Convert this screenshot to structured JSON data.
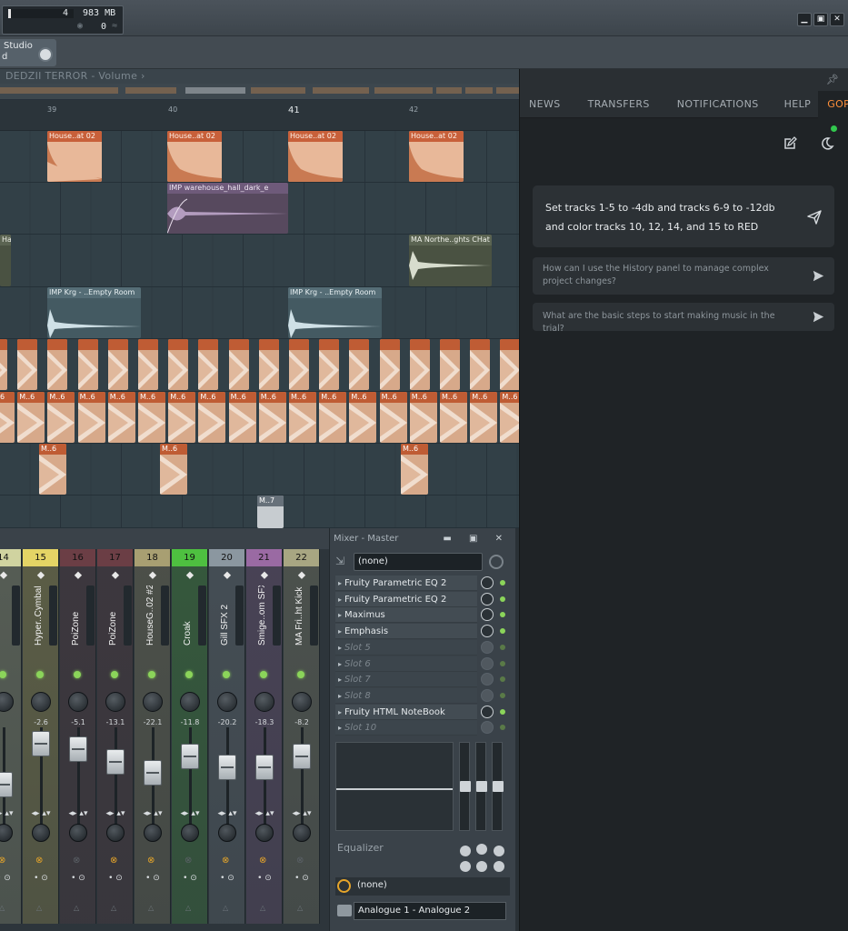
{
  "topbar": {
    "meter_count": "4",
    "meter_mem": "983 MB",
    "meter_poly": "0",
    "win_min": "▁",
    "win_max": "▣",
    "win_close": "✕"
  },
  "studio": {
    "line1": "Studio",
    "line2": "d"
  },
  "playlist": {
    "title": "DEDZII TERROR - Volume ›",
    "ruler": [
      "39",
      "40",
      "41",
      "42"
    ],
    "clips": {
      "house": "House..at 02",
      "imp_warehouse": "IMP warehouse_hall_dark_e",
      "hat_left": "Hat",
      "ma_northe": "MA Northe..ghts CHat",
      "imp_krg": "IMP Krg - ..Empty Room",
      "m6": "M..6",
      "m7": "M..7"
    }
  },
  "mixer": {
    "strips": [
      {
        "num": "14",
        "name": "",
        "val": "",
        "color": "#d0d3a0"
      },
      {
        "num": "15",
        "name": "Hyper..Cymbal",
        "val": "-2.6",
        "color": "#e4d465"
      },
      {
        "num": "16",
        "name": "PoiZone",
        "val": "-5.1",
        "color": "#6b3e45"
      },
      {
        "num": "17",
        "name": "PoiZone",
        "val": "-13.1",
        "color": "#6b3e45"
      },
      {
        "num": "18",
        "name": "HouseG..02 #2",
        "val": "-22.1",
        "color": "#a89f72"
      },
      {
        "num": "19",
        "name": "Croak",
        "val": "-11.8",
        "color": "#4ec040"
      },
      {
        "num": "20",
        "name": "Gill SFX 2",
        "val": "-20.2",
        "color": "#8b97a0"
      },
      {
        "num": "21",
        "name": "Smige..om SFX",
        "val": "-18.3",
        "color": "#9a6aa3"
      },
      {
        "num": "22",
        "name": "MA Fri..ht Kick",
        "val": "-8.2",
        "color": "#a8a682"
      }
    ],
    "master": {
      "title": "Mixer - Master",
      "win_buttons": "▬ ▣ ✕",
      "input": "(none)",
      "slots": [
        {
          "label": "Fruity Parametric EQ 2",
          "empty": false
        },
        {
          "label": "Fruity Parametric EQ 2",
          "empty": false
        },
        {
          "label": "Maximus",
          "empty": false
        },
        {
          "label": "Emphasis",
          "empty": false
        },
        {
          "label": "Slot 5",
          "empty": true
        },
        {
          "label": "Slot 6",
          "empty": true
        },
        {
          "label": "Slot 7",
          "empty": true
        },
        {
          "label": "Slot 8",
          "empty": true
        },
        {
          "label": "Fruity HTML NoteBook",
          "empty": false
        },
        {
          "label": "Slot 10",
          "empty": true
        }
      ],
      "eq_label": "Equalizer",
      "send": "(none)",
      "output": "Analogue 1 - Analogue 2"
    }
  },
  "side": {
    "tabs": [
      "NEWS",
      "TRANSFERS",
      "NOTIFICATIONS",
      "HELP",
      "GOPHER"
    ],
    "active_tab": "GOPHER",
    "accent": "#ff8f3a",
    "status_color": "#32c84e",
    "prompt": "Set tracks 1-5 to -4db and tracks 6-9 to -12db and color tracks 10, 12, 14, and 15 to RED",
    "suggestions": [
      "How can I use the History panel to manage complex project changes?",
      "What are the basic steps to start making music in the trial?"
    ],
    "icons": [
      "pin-icon",
      "new-chat-icon",
      "theme-moon-icon",
      "send-icon"
    ]
  }
}
